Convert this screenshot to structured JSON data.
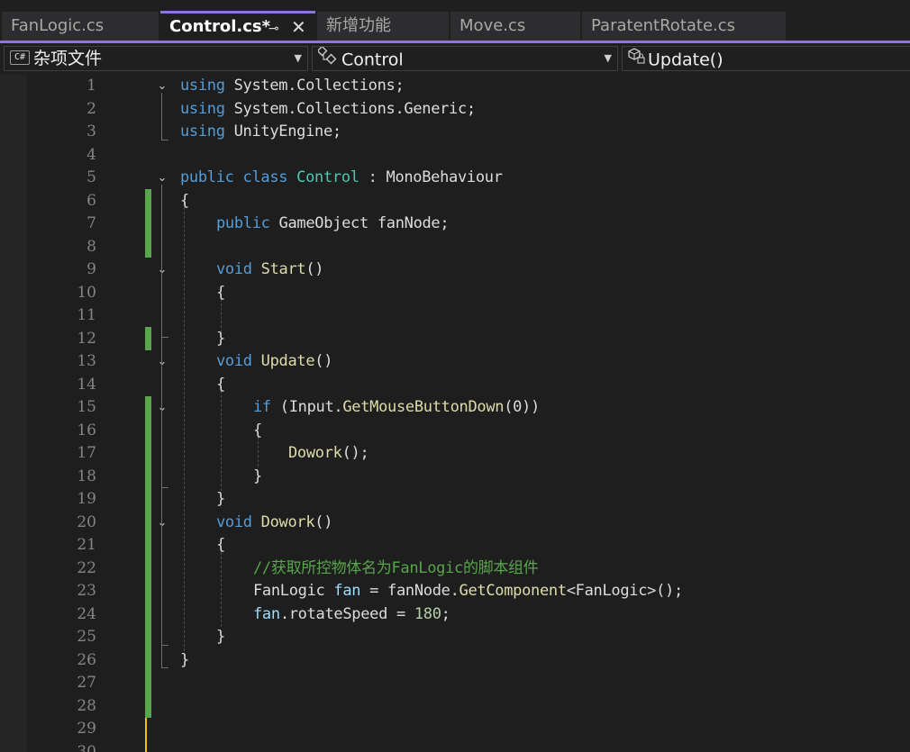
{
  "tabs": [
    {
      "label": "FanLogic.cs"
    },
    {
      "label": "Control.cs*",
      "pin": "⊸",
      "close": "✕"
    },
    {
      "label": "新增功能"
    },
    {
      "label": "Move.cs"
    },
    {
      "label": "ParatentRotate.cs"
    }
  ],
  "nav": {
    "project_badge": "C#",
    "project": "杂项文件",
    "type": "Control",
    "member": "Update()"
  },
  "line_numbers": [
    "1",
    "2",
    "3",
    "4",
    "5",
    "6",
    "7",
    "8",
    "9",
    "10",
    "11",
    "12",
    "13",
    "14",
    "15",
    "16",
    "17",
    "18",
    "19",
    "20",
    "21",
    "22",
    "23",
    "24",
    "25",
    "26",
    "27",
    "28",
    "29",
    "30"
  ],
  "code": {
    "l1": {
      "kw": "using",
      "rest": " System.Collections;"
    },
    "l2": {
      "kw": "using",
      "rest": " System.Collections.Generic;"
    },
    "l3": {
      "kw": "using",
      "rest": " UnityEngine;"
    },
    "l5": {
      "kw1": "public",
      "kw2": " class",
      "name": " Control",
      "rest": " : MonoBehaviour"
    },
    "l6": "{",
    "l7": {
      "kw": "public",
      "rest": " GameObject fanNode;"
    },
    "l9": {
      "kw": "void",
      "fn": " Start",
      "rest": "()"
    },
    "l10": "{",
    "l12": "}",
    "l13": {
      "kw": "void",
      "fn": " Update",
      "rest": "()"
    },
    "l14": "{",
    "l15": {
      "kw": "if",
      "open": " (Input.",
      "fn": "GetMouseButtonDown",
      "num": "(0))"
    },
    "l16": "{",
    "l17": {
      "fn": "Dowork",
      "rest": "();"
    },
    "l18": "}",
    "l19": "}",
    "l20": {
      "kw": "void",
      "fn": " Dowork",
      "rest": "()"
    },
    "l21": "{",
    "l22": "//获取所控物体名为FanLogic的脚本组件",
    "l23": {
      "p1": "FanLogic ",
      "var": "fan",
      "p2": " = fanNode.",
      "fn": "GetComponent",
      "p3": "<FanLogic>();"
    },
    "l24": {
      "var": "fan",
      "p1": ".rotateSpeed = ",
      "num": "180",
      "p2": ";"
    },
    "l25": "}",
    "l26": "}"
  },
  "colors": {
    "keyword": "#569cd6",
    "type": "#4ec9b0",
    "method": "#dcdcaa",
    "comment": "#57a64a",
    "number": "#b5cea8",
    "accent": "#8c76dc",
    "change_saved": "#57a64a",
    "change_unsaved": "#f5c000"
  },
  "icons": {
    "pin": "pin-icon",
    "close": "close-icon",
    "project": "csharp-project-icon",
    "type": "class-icon",
    "member": "method-icon",
    "fold": "chevron-down-icon"
  }
}
